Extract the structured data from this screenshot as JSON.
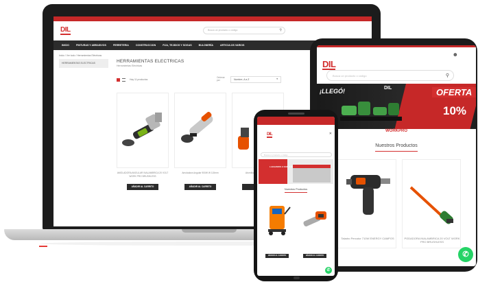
{
  "colors": {
    "brand_red": "#d32f2f",
    "nav_dark": "#2c2c2c",
    "whatsapp_green": "#25d366"
  },
  "laptop": {
    "logo": "DIL",
    "search_placeholder": "Busca un producto o código",
    "nav": [
      "INICIO",
      "PINTURAS Y ABRASIVOS",
      "FERRETERIA",
      "CONSTRUCCION",
      "FIJA, TEJIDOS Y SOGAS",
      "BULONERÍA",
      "ARTICULOS VARIOS"
    ],
    "breadcrumb": "Inicio / Ver todo / Herramientas Eléctricas",
    "sidebar_item": "HERRAMIENTAS ELECTRICAS",
    "page_title": "HERRAMIENTAS ELECTRICAS",
    "page_subtitle": "Herramientas Eléctricas",
    "results_count": "Hay 11 productos",
    "sort_label": "Ordenar por:",
    "sort_value": "Nombre, A a Z",
    "products": [
      {
        "name": "AMOLADORA ANGULAR INALAMBRICA 20 VOLT WORK PRO BRUSHLESS",
        "button": "AÑADIR AL CARRITO"
      },
      {
        "name": "Amoladora Angular 900W W 115mm",
        "button": "AÑADIR AL CARRITO"
      },
      {
        "name": "Atornillador 750W 10mm",
        "button": "AÑADIR"
      }
    ]
  },
  "tablet": {
    "logo": "DIL",
    "search_placeholder": "Busca un producto o código",
    "banner": {
      "headline": "¡LLEGÓ!",
      "logo": "DIL",
      "offer": "OFERTA",
      "percent": "10%",
      "brand": "WORKPRO"
    },
    "section_title": "Nuestros Productos",
    "products": [
      {
        "name": "Taladro Percutor 710W ENERGY CAMPOS"
      },
      {
        "name": "PODADORA INALAMBRICA 20 VOLT WORK PRO BRUSHLESS"
      }
    ],
    "whatsapp_icon": "whatsapp-icon"
  },
  "phone": {
    "logo": "DIL",
    "search_placeholder": "Busca un producto o código",
    "banner_text": "LLEGAMOS A SAN JUAN",
    "section_title": "Nuestros Productos",
    "products": [
      {
        "button": "AÑADIR AL CARRITO"
      },
      {
        "button": "AÑADIR AL CARRITO"
      }
    ],
    "whatsapp_icon": "whatsapp-icon"
  }
}
